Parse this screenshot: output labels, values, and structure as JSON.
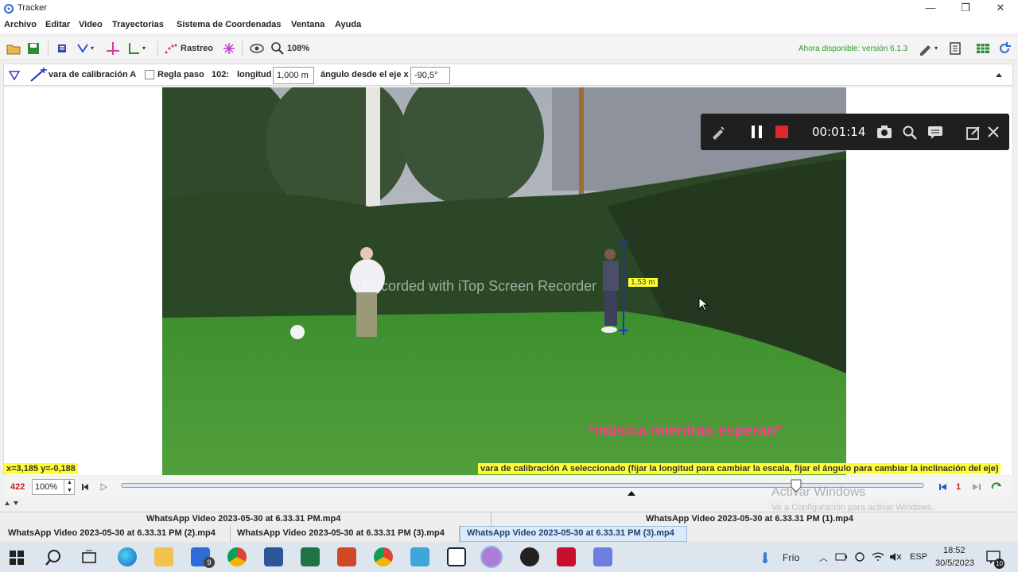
{
  "window": {
    "title": "Tracker",
    "minimize": "—",
    "maximize": "❐",
    "close": "✕"
  },
  "menu": [
    "Archivo",
    "Editar",
    "Video",
    "Trayectorias",
    "Sistema de Coordenadas",
    "Ventana",
    "Ayuda"
  ],
  "toolbar": {
    "track_label": "Rastreo",
    "zoom_label": "108%",
    "update_notice": "Ahora disponible: versión 6.1.3"
  },
  "trackbar": {
    "track_name": "vara de calibración A",
    "regla_label": "Regla paso",
    "step": "102:",
    "length_label": "longitud",
    "length_value": "1,000 m",
    "angle_label": "ángulo desde el eje x",
    "angle_value": "-90,5°"
  },
  "video": {
    "watermark": "Recorded with iTop Screen Recorder",
    "stick_label": "1,53 m",
    "caption": "*música mientras esperan*"
  },
  "recorder": {
    "time": "00:01:14"
  },
  "status": {
    "coords": "x=3,185  y=-0,188",
    "message": "vara de calibración A seleccionado (fijar la longitud para cambiar la escala, fijar el ángulo para cambiar la inclinación del eje)"
  },
  "player": {
    "frame": "422",
    "zoom": "100%",
    "step_count": "1",
    "slider_position": 0.84
  },
  "activate": {
    "line1": "Activar Windows",
    "line2": "Ve a Configuración para activar Windows."
  },
  "tabs_row1": [
    "WhatsApp Video 2023-05-30 at 6.33.31 PM.mp4",
    "WhatsApp Video 2023-05-30 at 6.33.31 PM (1).mp4"
  ],
  "tabs_row2": [
    "WhatsApp Video 2023-05-30 at 6.33.31 PM (2).mp4",
    "WhatsApp Video 2023-05-30 at 6.33.31 PM (3).mp4",
    "WhatsApp Video 2023-05-30 at 6.33.31 PM (3).mp4"
  ],
  "taskbar": {
    "weather": "Frío",
    "lang": "ESP",
    "time": "18:52",
    "date": "30/5/2023",
    "mail_badge": "9",
    "notif_badge": "10"
  },
  "colors": {
    "accent_green": "#2a9d2a",
    "frame_red": "#d01818",
    "highlight_yellow": "#ffff33",
    "calib_blue": "#1c2fd0"
  }
}
